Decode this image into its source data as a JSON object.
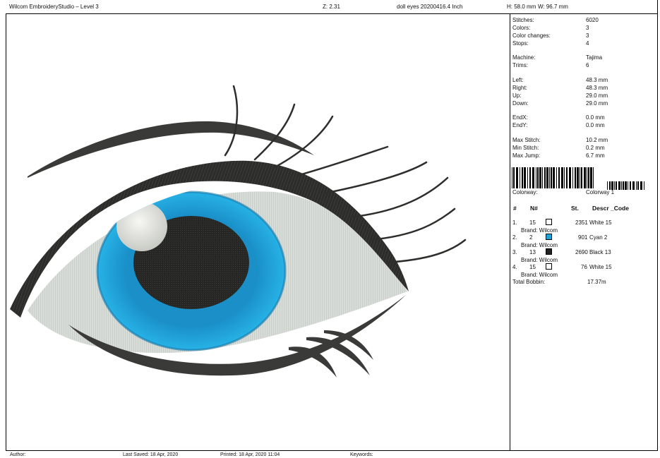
{
  "header": {
    "app_title": "Wilcom EmbroideryStudio – Level 3",
    "zoom": "Z: 2.31",
    "design_name": "doll eyes 20200416.4  Inch",
    "height": "H: 58.0 mm",
    "width": "W: 96.7 mm"
  },
  "stats": {
    "stitches": {
      "label": "Stitches:",
      "value": "6020"
    },
    "colors": {
      "label": "Colors:",
      "value": "3"
    },
    "color_changes": {
      "label": "Color changes:",
      "value": "3"
    },
    "stops": {
      "label": "Stops:",
      "value": "4"
    },
    "machine": {
      "label": "Machine:",
      "value": "Tajima"
    },
    "trims": {
      "label": "Trims:",
      "value": "6"
    },
    "left": {
      "label": "Left:",
      "value": "48.3 mm"
    },
    "right": {
      "label": "Right:",
      "value": "48.3 mm"
    },
    "up": {
      "label": "Up:",
      "value": "29.0 mm"
    },
    "down": {
      "label": "Down:",
      "value": "29.0 mm"
    },
    "endx": {
      "label": "EndX:",
      "value": "0.0 mm"
    },
    "endy": {
      "label": "EndY:",
      "value": "0.0 mm"
    },
    "max_stitch": {
      "label": "Max Stitch:",
      "value": "10.2 mm"
    },
    "min_stitch": {
      "label": "Min Stitch:",
      "value": "0.2 mm"
    },
    "max_jump": {
      "label": "Max Jump:",
      "value": "6.7 mm"
    }
  },
  "colorway": {
    "label": "Colorway:",
    "value": "Colorway 1"
  },
  "color_table": {
    "headers": {
      "index": "#",
      "needle": "N#",
      "stitches": "St.",
      "descr": "Descr _Code"
    },
    "brand_label": "Brand: Wilcom",
    "rows": [
      {
        "index": "1.",
        "needle": "15",
        "color": "#ffffff",
        "stitches": "2351",
        "descr": "White 15"
      },
      {
        "index": "2.",
        "needle": "2",
        "color": "#1fa3d9",
        "stitches": "901",
        "descr": "Cyan 2"
      },
      {
        "index": "3.",
        "needle": "13",
        "color": "#222222",
        "stitches": "2690",
        "descr": "Black 13"
      },
      {
        "index": "4.",
        "needle": "15",
        "color": "#ffffff",
        "stitches": "76",
        "descr": "White 15"
      }
    ]
  },
  "total_bobbin": {
    "label": "Total Bobbin:",
    "value": "17.37m"
  },
  "footer": {
    "author": "Author:",
    "last_saved": "Last Saved: 18 Apr, 2020",
    "printed": "Printed: 18 Apr, 2020 11:04",
    "keywords": "Keywords:"
  },
  "palette": {
    "outline": "#3a3a38",
    "iris": "#1fa3d9",
    "iris_dark": "#1577a8",
    "pupil": "#262624",
    "sclera": "#d6dbd6",
    "highlight": "#e8e8e4"
  }
}
